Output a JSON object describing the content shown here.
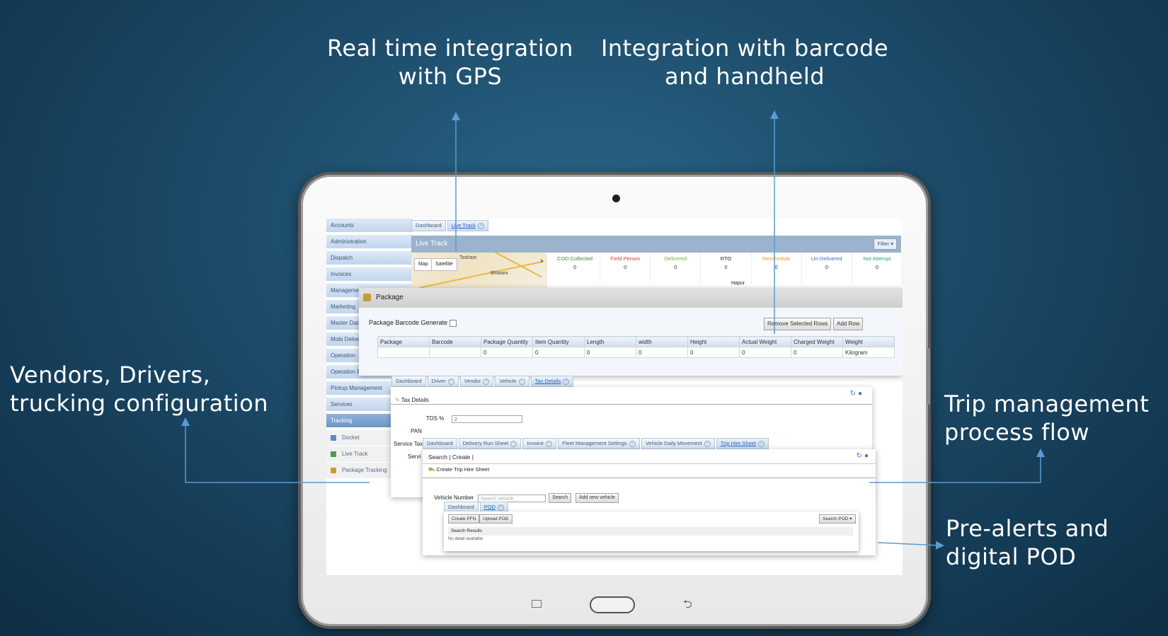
{
  "callouts": {
    "gps": [
      "Real time integration",
      "with GPS"
    ],
    "barcode": [
      "Integration with barcode",
      "and handheld"
    ],
    "vendors": [
      "Vendors, Drivers,",
      "trucking configuration"
    ],
    "trip": [
      "Trip management",
      "process flow"
    ],
    "pod": [
      "Pre-alerts and",
      "digital POD"
    ]
  },
  "sidebar": {
    "items": [
      "Accounts",
      "Administration",
      "Dispatch",
      "Invoices",
      "Management Report",
      "Marketing",
      "Master Data",
      "Mobi Delivery",
      "Operation",
      "Operation Report",
      "Pickup Management",
      "Services",
      "Tracking"
    ],
    "active": "Tracking",
    "subitems": [
      "Docket",
      "Live Track",
      "Package Tracking"
    ]
  },
  "livetrack": {
    "tabs": [
      "Dashboard",
      "Live Track"
    ],
    "title": "Live Track",
    "filter": "Filter ▾",
    "map_buttons": [
      "Map",
      "Satellite"
    ],
    "places": [
      "Tosham",
      "Bhiwani",
      "Hapur"
    ],
    "stats": [
      {
        "label": "COD Collected",
        "value": "0",
        "color": "#3b8a3b"
      },
      {
        "label": "Field Person",
        "value": "0",
        "color": "#d43b3b"
      },
      {
        "label": "Delivered",
        "value": "0",
        "color": "#6fb13a"
      },
      {
        "label": "RTO",
        "value": "0",
        "color": "#222222"
      },
      {
        "label": "Reschedule",
        "value": "0",
        "color": "#e49b1e"
      },
      {
        "label": "Un-Delivered",
        "value": "0",
        "color": "#3a6fc4"
      },
      {
        "label": "Not Attempt",
        "value": "0",
        "color": "#2aa37a"
      }
    ]
  },
  "package": {
    "title": "Package",
    "barcode_label": "Package Barcode Generate",
    "remove_btn": "Remove Selected Rows",
    "add_btn": "Add Row",
    "columns": [
      "Package",
      "Barcode",
      "Package Quantity",
      "Item Quantity",
      "Length",
      "width",
      "Height",
      "Actual Weight",
      "Charged Weight",
      "Weight"
    ],
    "row": [
      "",
      "",
      "0",
      "0",
      "0",
      "0",
      "0",
      "0",
      "0",
      "Kilogram"
    ]
  },
  "tax": {
    "tabs": [
      "Dashboard",
      "Driver",
      "Vendor",
      "Vehicle",
      "Tax Details"
    ],
    "title": "Tax Details",
    "tds_label": "TDS %",
    "tds_value": "2",
    "pan_label": "PAN",
    "service_tax_label": "Service Tax",
    "servi_label": "Servi"
  },
  "trip": {
    "tabs": [
      "Dashboard",
      "Delivery Run Sheet",
      "Invoice",
      "Fleet Management Settings",
      "Vehicle Daily Movement",
      "Trip Hire Sheet"
    ],
    "menu": [
      "Search",
      "Create"
    ],
    "title": "Create Trip Hire Sheet",
    "vehicle_label": "Vehicle Number",
    "vehicle_placeholder": "Search Vehicle",
    "search_btn": "Search",
    "add_vehicle_btn": "Add new vehicle"
  },
  "pod": {
    "tabs": [
      "Dashboard",
      "POD"
    ],
    "create_btn": "Create PFN",
    "upload_btn": "Upload POD",
    "search_btn": "Search POD ▾",
    "results_label": "Search Results",
    "empty_text": "No detail available"
  }
}
